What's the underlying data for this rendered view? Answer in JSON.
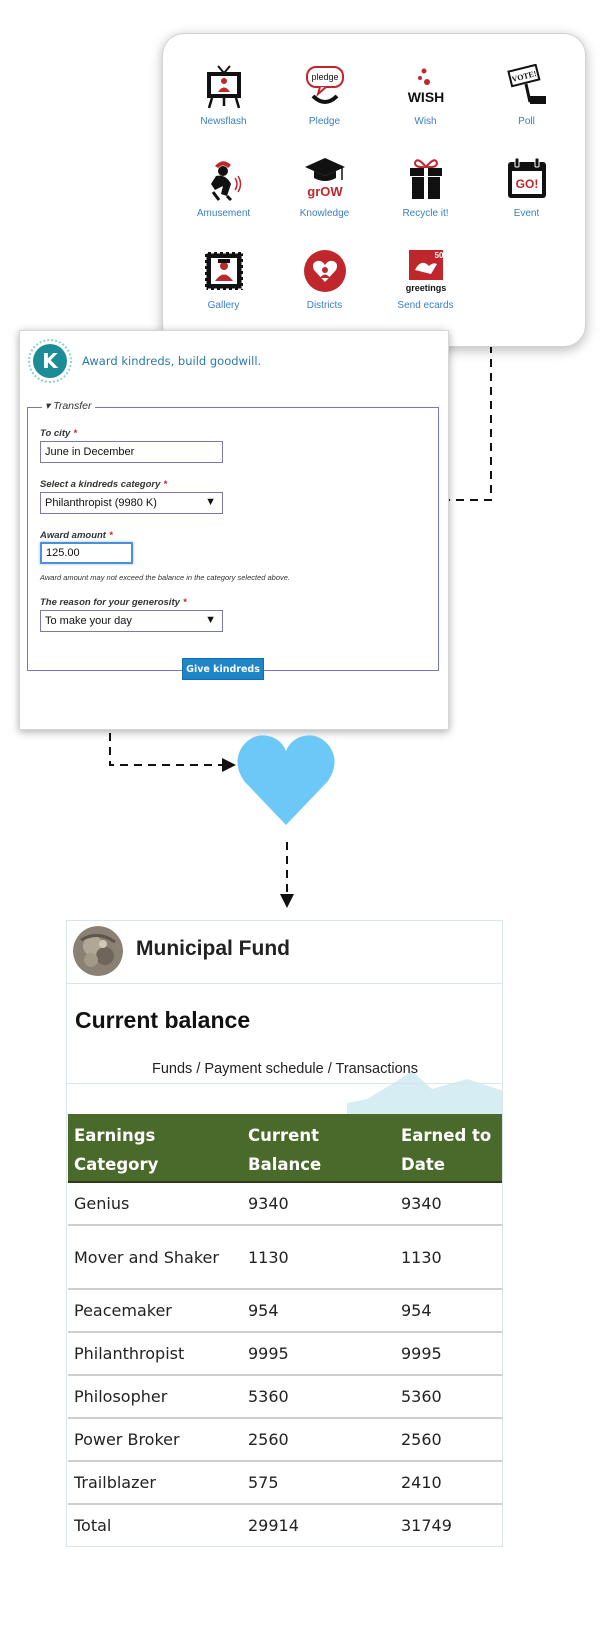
{
  "menu": {
    "items": [
      {
        "label": "Newsflash",
        "icon": "tv-icon"
      },
      {
        "label": "Pledge",
        "icon": "pledge-icon",
        "icon_text": "pledge"
      },
      {
        "label": "Wish",
        "icon": "wish-icon",
        "icon_text": "WISH"
      },
      {
        "label": "Poll",
        "icon": "vote-sign-icon",
        "icon_text": "VOTE!"
      },
      {
        "label": "Amusement",
        "icon": "jester-icon"
      },
      {
        "label": "Knowledge",
        "icon": "graduation-cap-icon",
        "icon_text": "grOW"
      },
      {
        "label": "Recycle it!",
        "icon": "gift-box-icon"
      },
      {
        "label": "Event",
        "icon": "calendar-icon",
        "icon_text": "GO!"
      },
      {
        "label": "Gallery",
        "icon": "stamp-icon"
      },
      {
        "label": "Districts",
        "icon": "heart-circle-icon"
      },
      {
        "label": "Send ecards",
        "icon": "ecard-icon",
        "icon_text": "greetings",
        "icon_badge": "50"
      }
    ]
  },
  "form": {
    "logo_letter": "K",
    "tagline": "Award kindreds, build goodwill.",
    "legend": "Transfer",
    "legend_marker": "▾",
    "required_mark": "*",
    "to_city": {
      "label": "To city",
      "value": "June in December"
    },
    "category": {
      "label": "Select a kindreds category",
      "value": "Philanthropist (9980 K)"
    },
    "amount": {
      "label": "Award amount",
      "value": "125.00",
      "hint": "Award amount may not exceed the balance in the category selected above."
    },
    "reason": {
      "label": "The reason for your generosity",
      "value": "To make your day"
    },
    "submit_label": "Give kindreds"
  },
  "fund": {
    "title": "Municipal Fund",
    "balance_title": "Current balance",
    "nav": [
      "Funds",
      "Payment schedule",
      "Transactions"
    ],
    "nav_separator": " / ",
    "table": {
      "headers": [
        "Earnings Category",
        "Current Balance",
        "Earned to Date"
      ],
      "rows": [
        {
          "category": "Genius",
          "current": "9340",
          "earned": "9340"
        },
        {
          "category": "Mover and Shaker",
          "current": "1130",
          "earned": "1130"
        },
        {
          "category": "Peacemaker",
          "current": "954",
          "earned": "954"
        },
        {
          "category": "Philanthropist",
          "current": "9995",
          "earned": "9995"
        },
        {
          "category": "Philosopher",
          "current": "5360",
          "earned": "5360"
        },
        {
          "category": "Power Broker",
          "current": "2560",
          "earned": "2560"
        },
        {
          "category": "Trailblazer",
          "current": "575",
          "earned": "2410"
        },
        {
          "category": "Total",
          "current": "29914",
          "earned": "31749"
        }
      ]
    }
  },
  "colors": {
    "accent_blue": "#3a7fc0",
    "button_blue": "#1d85c8",
    "heart_blue": "#6cc8f6",
    "table_header_green": "#4a6a2b",
    "icon_red": "#c0272d"
  }
}
